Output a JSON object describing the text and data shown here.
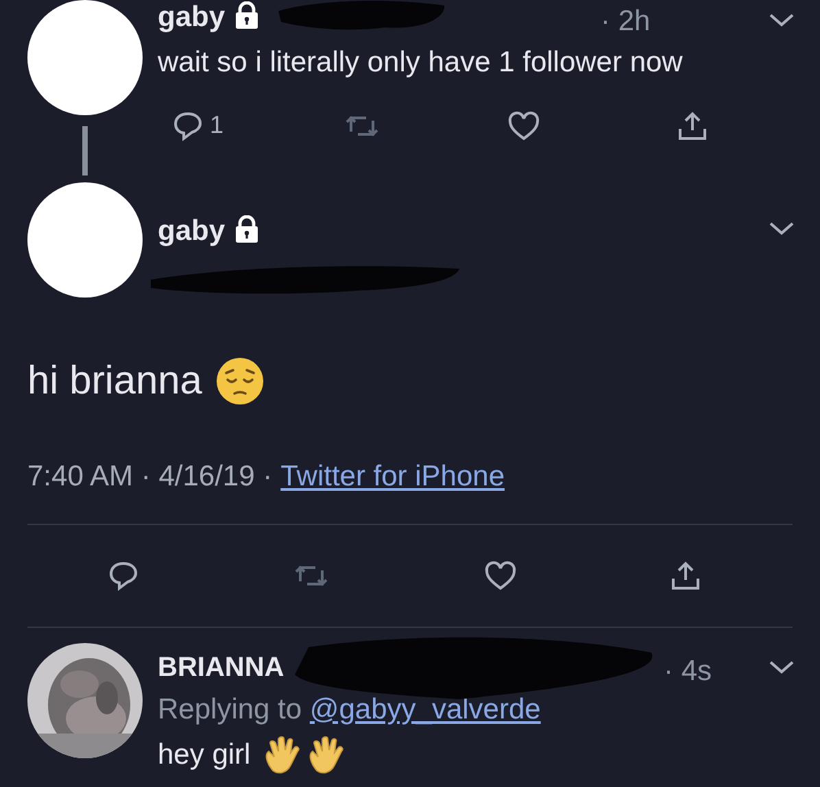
{
  "parent_tweet": {
    "name": "gaby",
    "protected": true,
    "time": "· 2h",
    "text": "wait so i literally only have 1 follower now",
    "reply_count": "1"
  },
  "main_tweet": {
    "name": "gaby",
    "protected": true,
    "text": "hi brianna",
    "timestamp": "7:40 AM · 4/16/19 ·",
    "source": "Twitter for iPhone"
  },
  "reply_tweet": {
    "name": "BRIANNA",
    "time": "· 4s",
    "replying_label": "Replying to",
    "replying_handle": "@gabyy_valverde",
    "text": "hey girl"
  }
}
